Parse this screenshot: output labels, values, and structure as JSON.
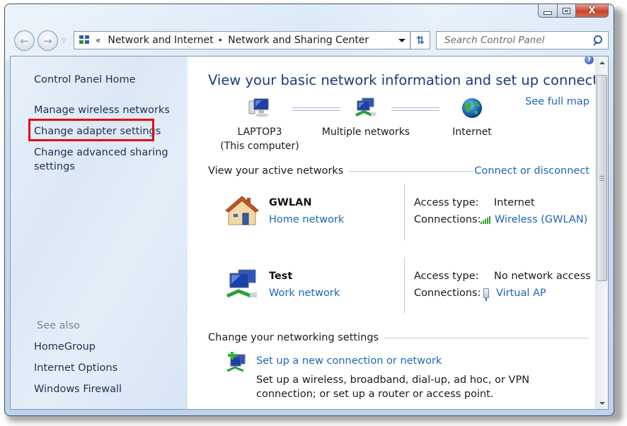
{
  "window": {
    "caption_buttons": {
      "minimize": "minimize",
      "maximize": "maximize",
      "close": "close"
    }
  },
  "toolbar": {
    "back_label": "Back",
    "forward_label": "Forward",
    "breadcrumb": {
      "overflow": "«",
      "items": [
        "Network and Internet",
        "Network and Sharing Center"
      ],
      "separator": "▸"
    },
    "refresh_label": "Refresh",
    "search": {
      "placeholder": "Search Control Panel",
      "value": ""
    }
  },
  "sidebar": {
    "home": "Control Panel Home",
    "tasks": [
      {
        "label": "Manage wireless networks"
      },
      {
        "label": "Change adapter settings",
        "highlighted": true
      },
      {
        "label": "Change advanced sharing settings",
        "line1": "Change advanced sharing",
        "line2": "settings"
      }
    ],
    "see_also_title": "See also",
    "see_also": [
      {
        "label": "HomeGroup"
      },
      {
        "label": "Internet Options"
      },
      {
        "label": "Windows Firewall"
      }
    ],
    "highlight_color": "#e8060a"
  },
  "main": {
    "title": "View your basic network information and set up connections",
    "see_full_map": "See full map",
    "map": [
      {
        "name": "LAPTOP3",
        "sub": "(This computer)",
        "icon": "computer-icon"
      },
      {
        "name": "Multiple networks",
        "icon": "multiple-networks-icon"
      },
      {
        "name": "Internet",
        "icon": "globe-icon"
      }
    ],
    "active_networks_header": "View your active networks",
    "connect_or_disconnect": "Connect or disconnect",
    "networks": [
      {
        "name": "GWLAN",
        "type": "Home network",
        "icon": "home-network-icon",
        "access_type_label": "Access type:",
        "access_type": "Internet",
        "connections_label": "Connections:",
        "connection": "Wireless (GWLAN)",
        "connection_icon": "wireless-signal-icon"
      },
      {
        "name": "Test",
        "type": "Work network",
        "icon": "work-network-icon",
        "access_type_label": "Access type:",
        "access_type": "No network access",
        "connections_label": "Connections:",
        "connection": "Virtual AP",
        "connection_icon": "network-adapter-icon"
      }
    ],
    "change_settings_header": "Change your networking settings",
    "tasks": [
      {
        "title": "Set up a new connection or network",
        "description": "Set up a wireless, broadband, dial-up, ad hoc, or VPN connection; or set up a router or access point.",
        "icon": "new-connection-icon"
      }
    ]
  },
  "colors": {
    "link": "#1f66b8",
    "title": "#1c3a7e",
    "sidebar_text": "#1e3151",
    "signal_green": "#35a02a"
  }
}
